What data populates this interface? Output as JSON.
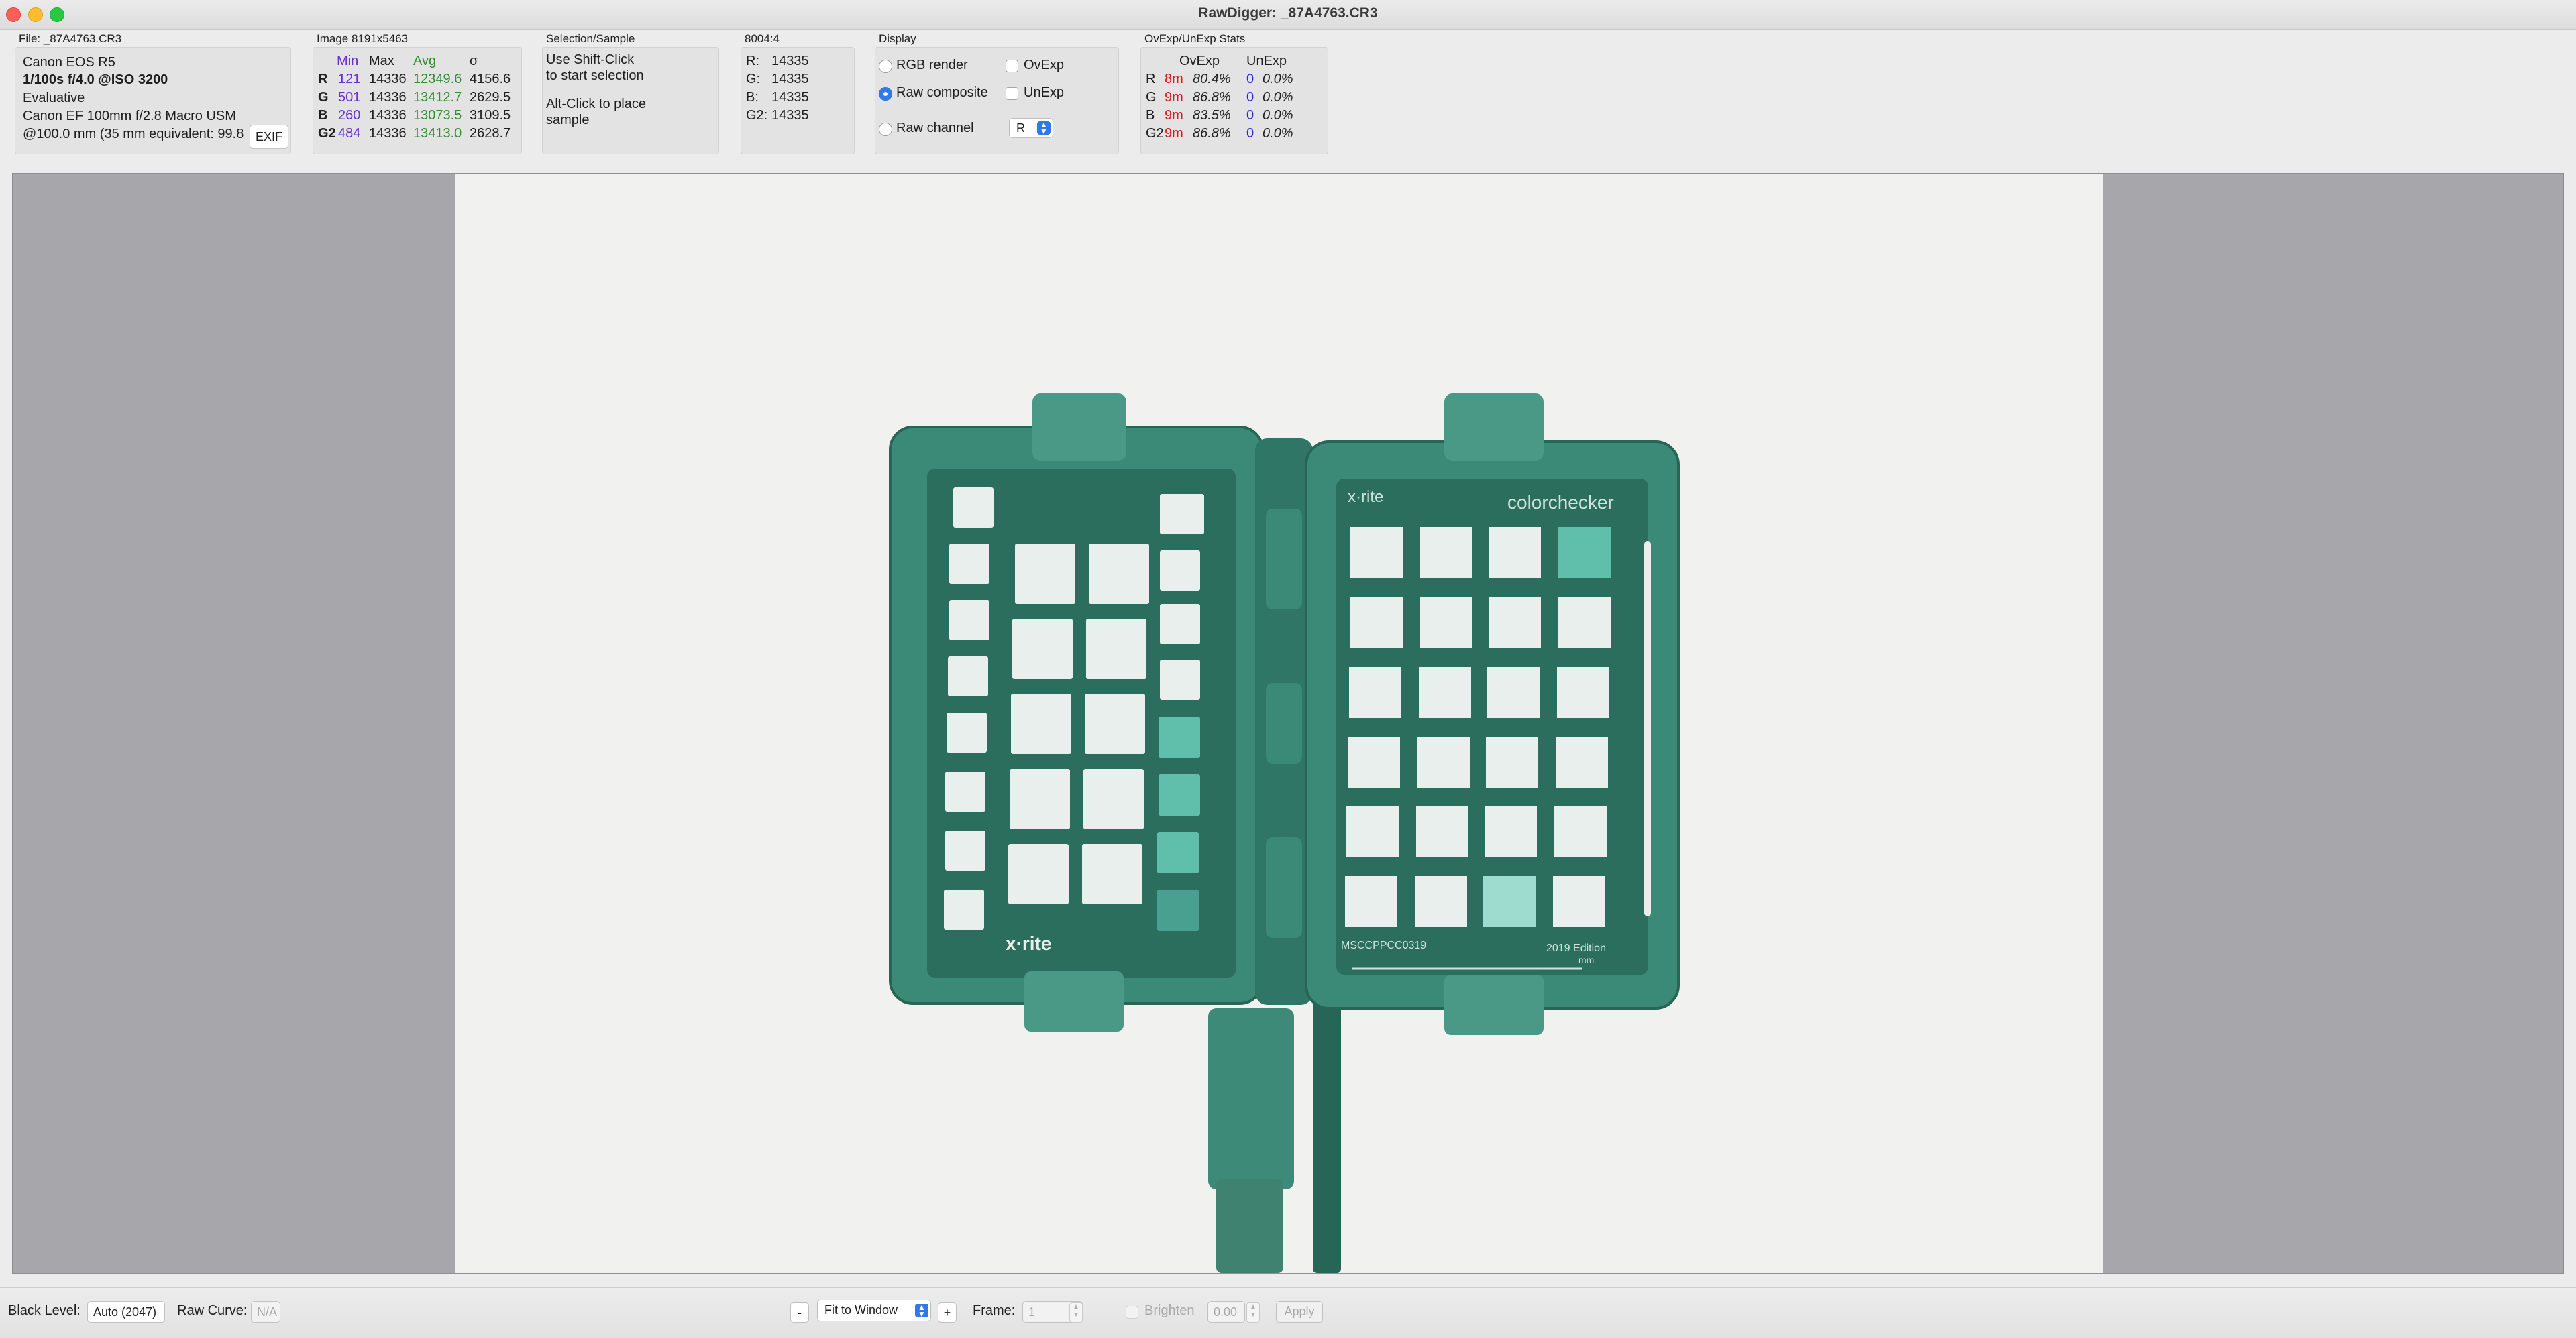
{
  "window": {
    "title": "RawDigger: _87A4763.CR3"
  },
  "file_panel": {
    "label": "File: _87A4763.CR3",
    "camera": "Canon EOS R5",
    "exposure": "1/100s f/4.0 @ISO 3200",
    "metering": "Evaluative",
    "lens": "Canon EF 100mm f/2.8 Macro USM",
    "focal": "@100.0 mm (35 mm equivalent: 99.8",
    "exif_button": "EXIF"
  },
  "image_panel": {
    "label": "Image 8191x5463",
    "headers": {
      "min": "Min",
      "max": "Max",
      "avg": "Avg",
      "sigma": "σ"
    },
    "rows": [
      {
        "ch": "R",
        "min": "121",
        "max": "14336",
        "avg": "12349.6",
        "sigma": "4156.6"
      },
      {
        "ch": "G",
        "min": "501",
        "max": "14336",
        "avg": "13412.7",
        "sigma": "2629.5"
      },
      {
        "ch": "B",
        "min": "260",
        "max": "14336",
        "avg": "13073.5",
        "sigma": "3109.5"
      },
      {
        "ch": "G2",
        "min": "484",
        "max": "14336",
        "avg": "13413.0",
        "sigma": "2628.7"
      }
    ]
  },
  "selection_panel": {
    "label": "Selection/Sample",
    "line1": "Use Shift-Click",
    "line2": "to start selection",
    "line3": "Alt-Click to place",
    "line4": "sample"
  },
  "sample_panel": {
    "label": "8004:4",
    "rows": [
      {
        "ch": "R:",
        "val": "14335"
      },
      {
        "ch": "G:",
        "val": "14335"
      },
      {
        "ch": "B:",
        "val": "14335"
      },
      {
        "ch": "G2:",
        "val": "14335"
      }
    ]
  },
  "display_panel": {
    "label": "Display",
    "rgb_render": "RGB render",
    "raw_composite": "Raw composite",
    "raw_channel": "Raw channel",
    "ovexp": "OvExp",
    "unexp": "UnExp",
    "channel_value": "R"
  },
  "stats_panel": {
    "label": "OvExp/UnExp Stats",
    "h_ov": "OvExp",
    "h_un": "UnExp",
    "rows": [
      {
        "ch": "R",
        "ov_count": "8m",
        "ov_pct": "80.4%",
        "un_count": "0",
        "un_pct": "0.0%"
      },
      {
        "ch": "G",
        "ov_count": "9m",
        "ov_pct": "86.8%",
        "un_count": "0",
        "un_pct": "0.0%"
      },
      {
        "ch": "B",
        "ov_count": "9m",
        "ov_pct": "83.5%",
        "un_count": "0",
        "un_pct": "0.0%"
      },
      {
        "ch": "G2",
        "ov_count": "9m",
        "ov_pct": "86.8%",
        "un_count": "0",
        "un_pct": "0.0%"
      }
    ]
  },
  "viewer": {
    "logo_left": "x·rite",
    "logo_right": "x·rite",
    "brand": "colorchecker",
    "code_left": "MSCCPPCC0319",
    "edition": "2019 Edition",
    "mm": "mm"
  },
  "bottom": {
    "black_level_label": "Black Level:",
    "black_level_value": "Auto (2047)",
    "raw_curve_label": "Raw Curve:",
    "raw_curve_value": "N/A",
    "zoom_minus": "-",
    "zoom_mode": "Fit to Window",
    "zoom_plus": "+",
    "frame_label": "Frame:",
    "frame_value": "1",
    "brighten_label": "Brighten",
    "brighten_value": "0.00",
    "apply": "Apply"
  }
}
